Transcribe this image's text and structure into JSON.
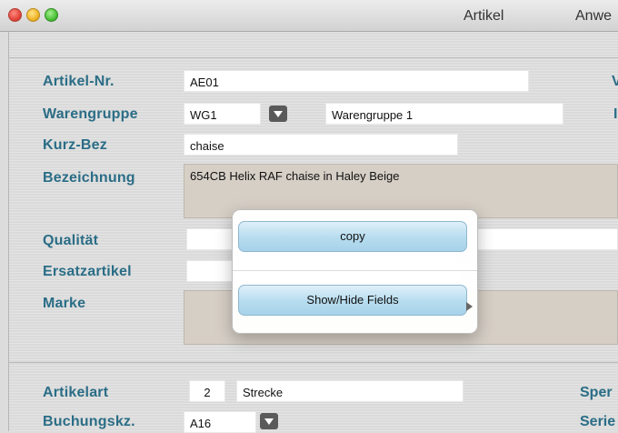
{
  "titlebar": {
    "menus": [
      "Artikel",
      "Anwe"
    ]
  },
  "form": {
    "artikel_nr": {
      "label": "Artikel-Nr.",
      "value": "AE01"
    },
    "warengruppe": {
      "label": "Warengruppe",
      "code": "WG1",
      "name": "Warengruppe 1"
    },
    "kurz_bez": {
      "label": "Kurz-Bez",
      "value": "chaise"
    },
    "bezeichnung": {
      "label": "Bezeichnung",
      "value": "654CB Helix RAF chaise in Haley Beige"
    },
    "qualitaet": {
      "label": "Qualität",
      "value": ""
    },
    "ersatzartikel": {
      "label": "Ersatzartikel",
      "value": ""
    },
    "marke": {
      "label": "Marke",
      "value": ""
    },
    "artikelart": {
      "label": "Artikelart",
      "code": "2",
      "name": "Strecke"
    },
    "buchungskz": {
      "label": "Buchungskz.",
      "code": "A16"
    },
    "right_labels": {
      "r1": "V",
      "r2": "I",
      "sperr": "Sper",
      "serie": "Serie"
    }
  },
  "context_menu": {
    "items": [
      "copy",
      "Show/Hide Fields"
    ]
  },
  "colors": {
    "label": "#2a6d86",
    "menu_button": "#b6dcef"
  }
}
